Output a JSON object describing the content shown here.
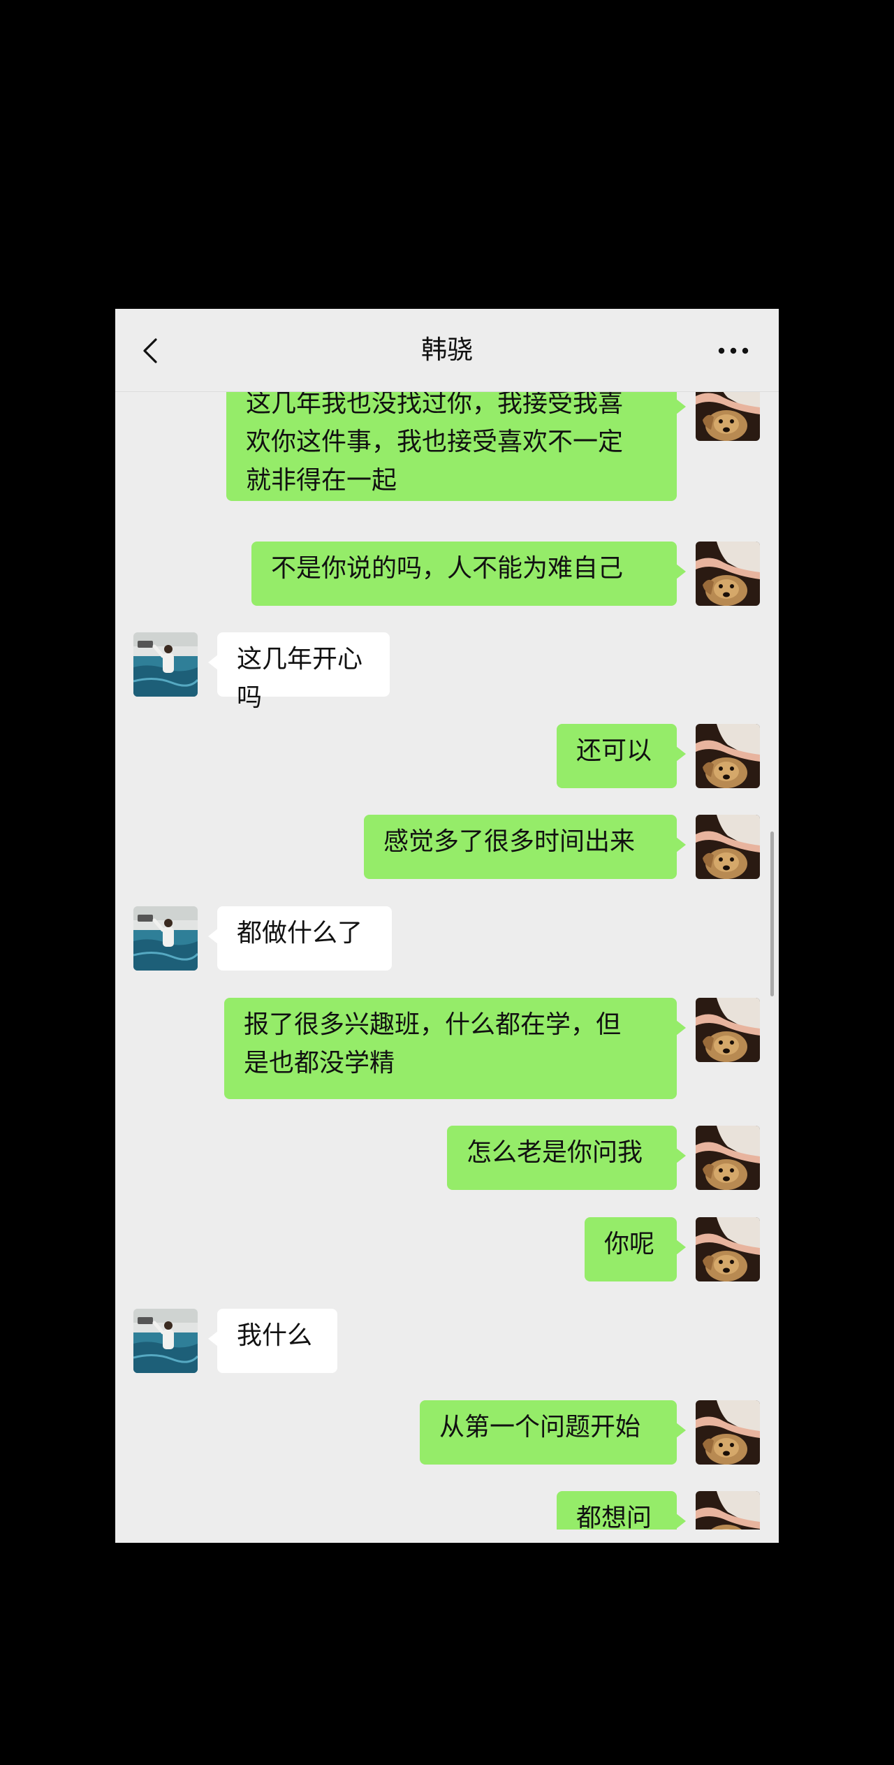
{
  "header": {
    "title": "韩骁",
    "back_icon": "chevron-left-icon",
    "more_icon": "more-dots-icon"
  },
  "colors": {
    "outgoing_bubble": "#95ec69",
    "incoming_bubble": "#ffffff",
    "background": "#ededed"
  },
  "messages": [
    {
      "from": "me",
      "text": "这几年我也没找过你，我接受我喜\n欢你这件事，我也接受喜欢不一定\n就非得在一起"
    },
    {
      "from": "me",
      "text": "不是你说的吗，人不能为难自己"
    },
    {
      "from": "them",
      "text": "这几年开心吗"
    },
    {
      "from": "me",
      "text": "还可以"
    },
    {
      "from": "me",
      "text": "感觉多了很多时间出来"
    },
    {
      "from": "them",
      "text": "都做什么了"
    },
    {
      "from": "me",
      "text": "报了很多兴趣班，什么都在学，但\n是也都没学精"
    },
    {
      "from": "me",
      "text": "怎么老是你问我"
    },
    {
      "from": "me",
      "text": "你呢"
    },
    {
      "from": "them",
      "text": "我什么"
    },
    {
      "from": "me",
      "text": "从第一个问题开始"
    },
    {
      "from": "me",
      "text": "都想问"
    }
  ]
}
